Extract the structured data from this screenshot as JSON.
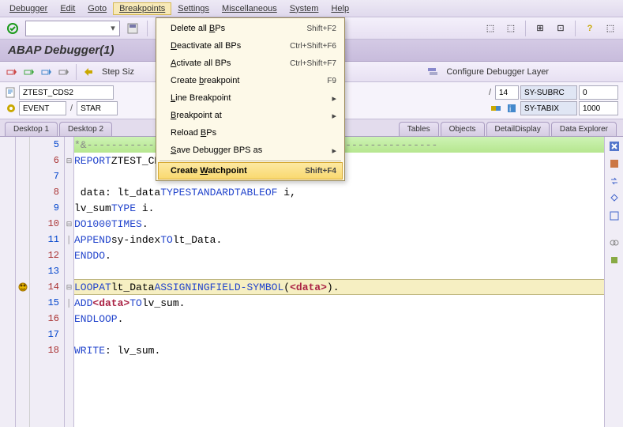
{
  "menubar": [
    "Debugger",
    "Edit",
    "Goto",
    "Breakpoints",
    "Settings",
    "Miscellaneous",
    "System",
    "Help"
  ],
  "title": "ABAP Debugger(1)",
  "subtoolbar": {
    "stepsize_lbl": "Step Siz",
    "layer_lbl": "Configure Debugger Layer"
  },
  "dropdown": {
    "items": [
      {
        "label": "Delete all BPs",
        "shortcut": "Shift+F2",
        "u": 11
      },
      {
        "label": "Deactivate all BPs",
        "shortcut": "Ctrl+Shift+F6",
        "u": 0
      },
      {
        "label": "Activate all BPs",
        "shortcut": "Ctrl+Shift+F7",
        "u": 0
      },
      {
        "label": "Create breakpoint",
        "shortcut": "F9",
        "u": 7
      },
      {
        "label": "Line Breakpoint",
        "arrow": true,
        "u": 0
      },
      {
        "label": "Breakpoint at",
        "arrow": true,
        "u": 0
      },
      {
        "label": "Reload BPs",
        "u": 7
      },
      {
        "label": "Save Debugger BPS as",
        "arrow": true,
        "u": 0
      },
      {
        "label": "Create Watchpoint",
        "shortcut": "Shift+F4",
        "hover": true,
        "u": 7
      }
    ]
  },
  "info": {
    "prog": "ZTEST_CDS2",
    "evt": "EVENT",
    "evtval": "STAR",
    "line": "14",
    "subrc_lbl": "SY-SUBRC",
    "subrc_val": "0",
    "tabix_lbl": "SY-TABIX",
    "tabix_val": "1000"
  },
  "tabs": [
    "Desktop 1",
    "Desktop 2",
    "Tables",
    "Objects",
    "DetailDisplay",
    "Data Explorer"
  ],
  "code": {
    "start": 5,
    "lines": [
      "*&---------------------------------------------------------",
      "REPORT ZTEST_CDS2.",
      "",
      "data: lt_data TYPE STANDARD TABLE OF i,",
      "      lv_sum TYPE i.",
      "DO 1000 TIMES.",
      "  APPEND sy-index TO lt_Data.",
      "ENDDO.",
      "",
      "LOOP AT lt_Data ASSIGNING FIELD-SYMBOL(<data>).",
      "  ADD <data> TO lv_sum.",
      "ENDLOOP.",
      "",
      "WRITE: lv_sum."
    ],
    "folds": {
      "6": "⊟",
      "10": "⊟",
      "14": "⊟"
    },
    "breakpoint_line": 14,
    "current_line": 14,
    "comment_line": 5
  }
}
